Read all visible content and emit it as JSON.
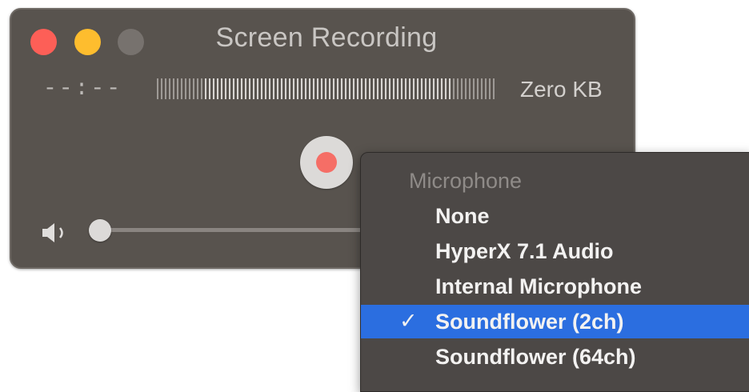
{
  "window": {
    "title": "Screen Recording",
    "elapsed_time": "--:--",
    "file_size": "Zero KB"
  },
  "controls": {
    "record_button_icon": "record-icon",
    "volume_icon": "speaker-icon",
    "volume_level": 0
  },
  "menu": {
    "header": "Microphone",
    "items": [
      {
        "label": "None",
        "selected": false
      },
      {
        "label": "HyperX 7.1 Audio",
        "selected": false
      },
      {
        "label": "Internal Microphone",
        "selected": false
      },
      {
        "label": "Soundflower (2ch)",
        "selected": true
      },
      {
        "label": "Soundflower (64ch)",
        "selected": false
      }
    ],
    "check_glyph": "✓"
  },
  "colors": {
    "window_bg": "#58534e",
    "close": "#fd5f57",
    "minimize": "#febd2e",
    "record": "#f56e66",
    "menu_bg": "#4c4846",
    "selection": "#2b6ee0"
  }
}
